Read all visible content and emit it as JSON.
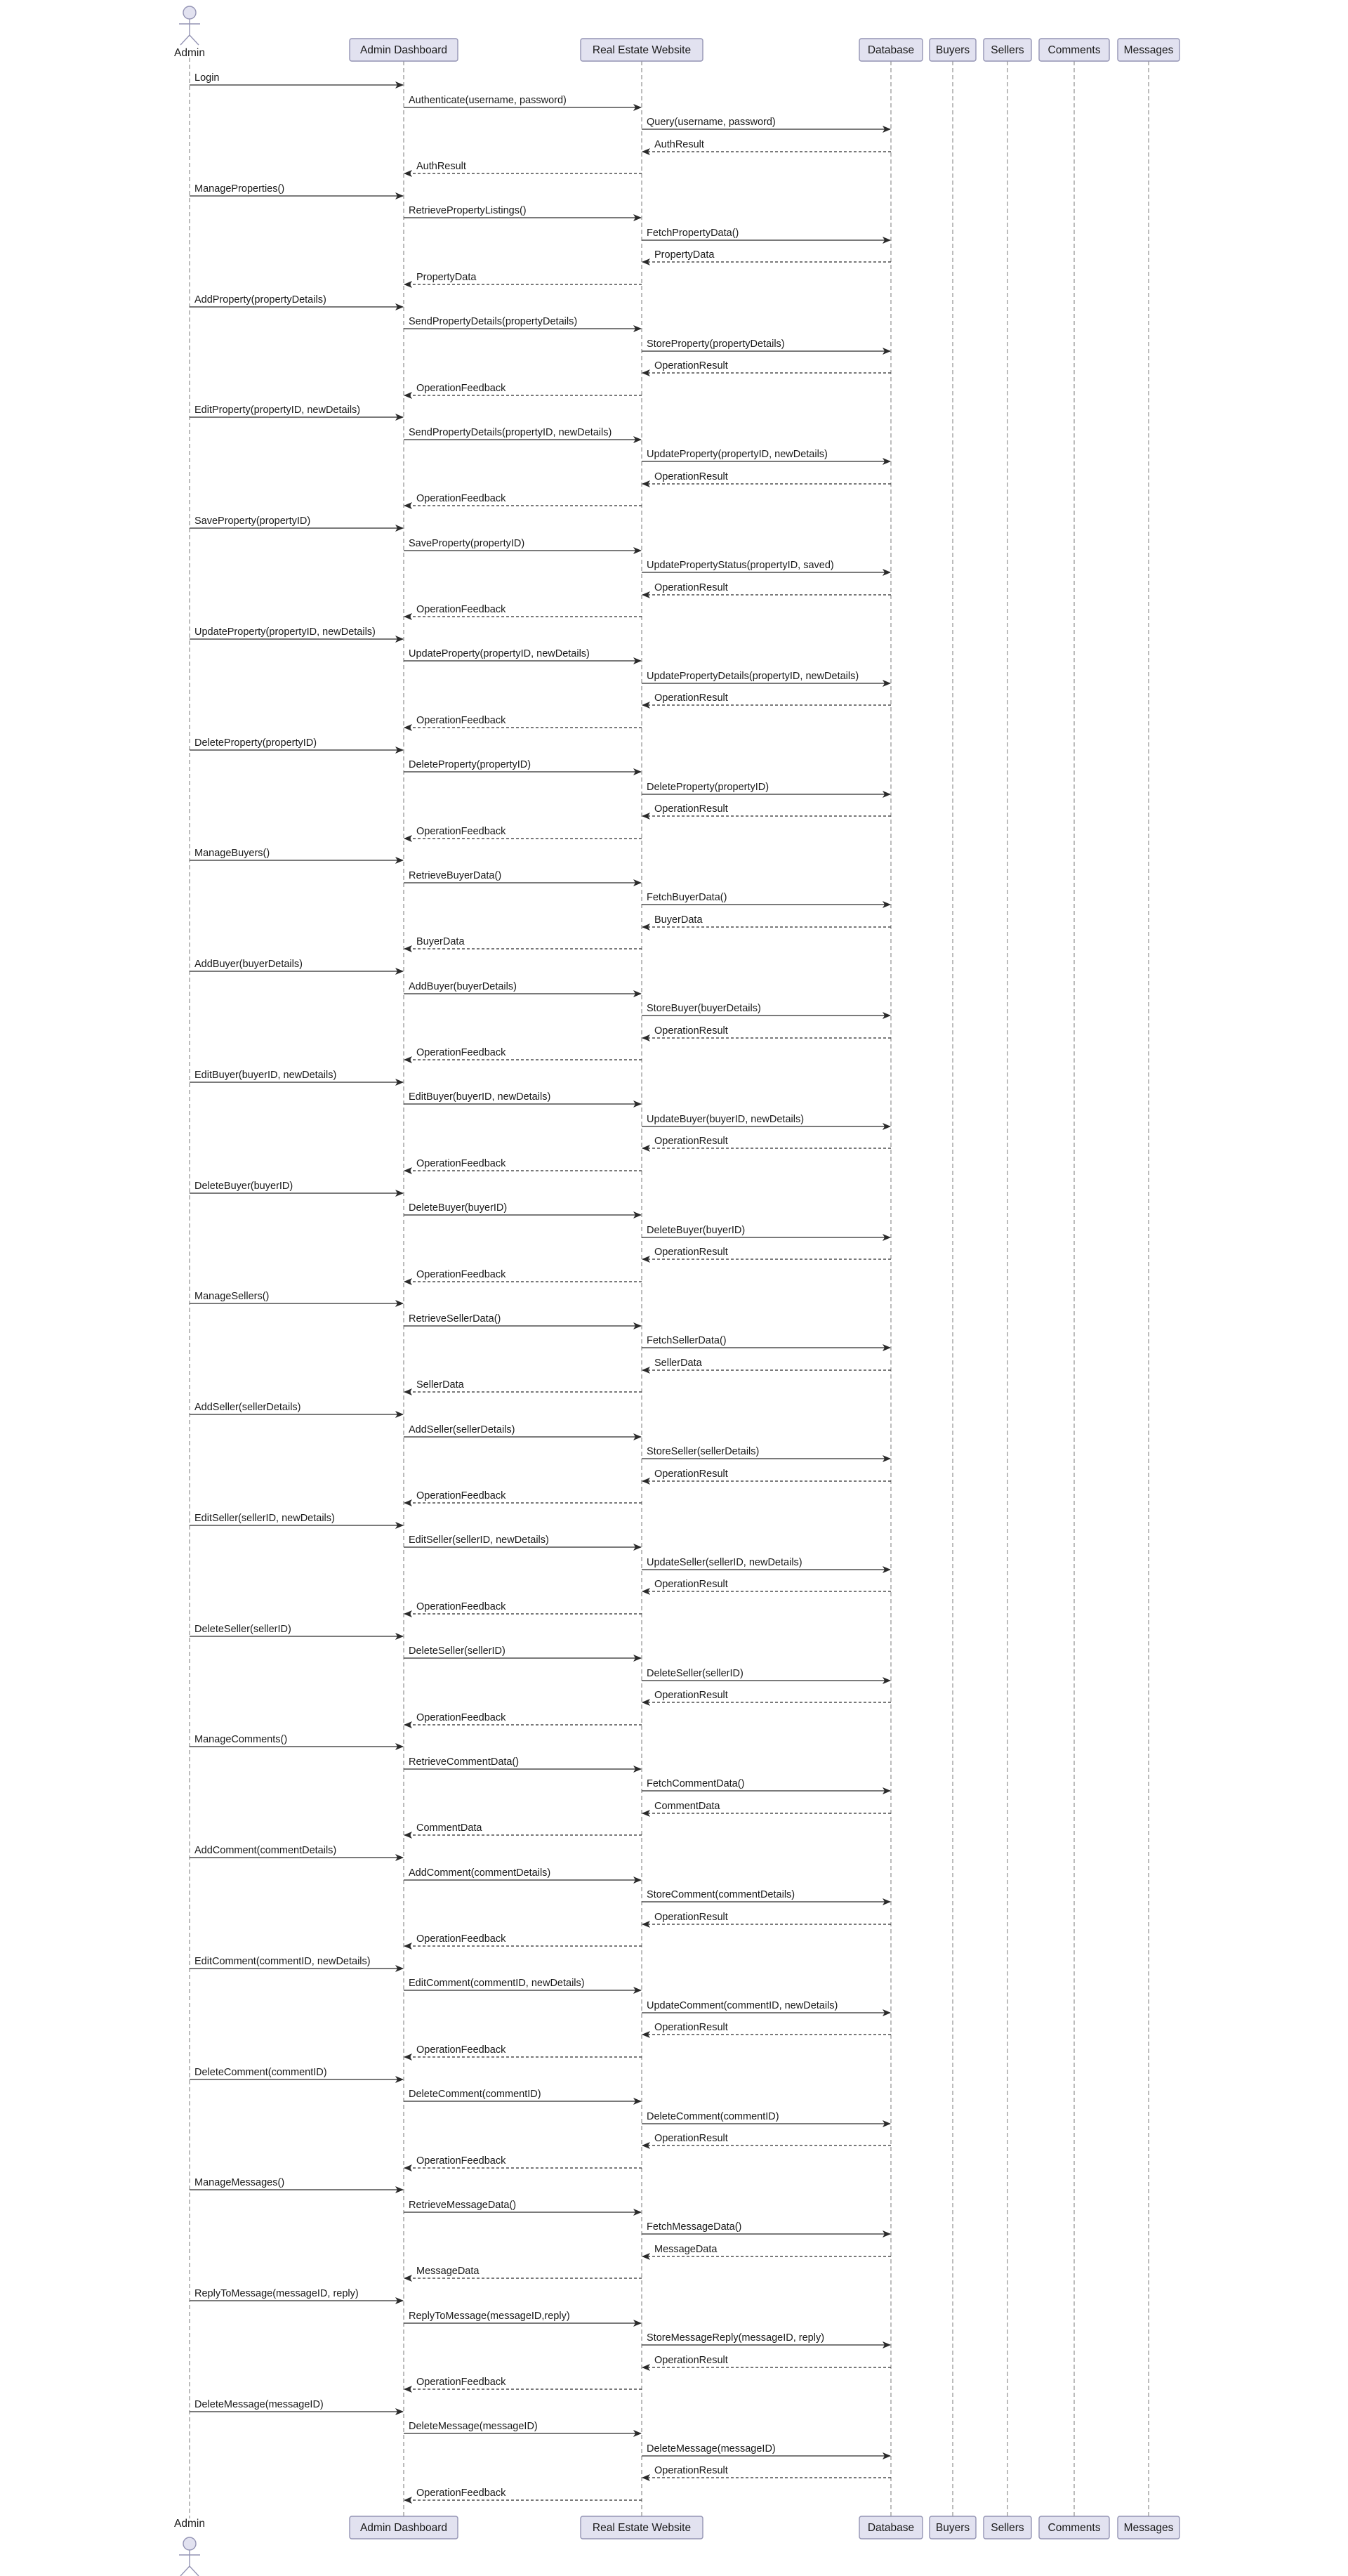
{
  "participants": [
    {
      "id": "admin",
      "label": "Admin",
      "kind": "actor"
    },
    {
      "id": "dashboard",
      "label": "Admin Dashboard",
      "kind": "box"
    },
    {
      "id": "website",
      "label": "Real Estate Website",
      "kind": "box"
    },
    {
      "id": "database",
      "label": "Database",
      "kind": "box"
    },
    {
      "id": "buyers",
      "label": "Buyers",
      "kind": "box"
    },
    {
      "id": "sellers",
      "label": "Sellers",
      "kind": "box"
    },
    {
      "id": "comments",
      "label": "Comments",
      "kind": "box"
    },
    {
      "id": "messages",
      "label": "Messages",
      "kind": "box"
    }
  ],
  "messages": [
    {
      "from": "admin",
      "to": "dashboard",
      "label": "Login",
      "type": "sync"
    },
    {
      "from": "dashboard",
      "to": "website",
      "label": "Authenticate(username, password)",
      "type": "sync"
    },
    {
      "from": "website",
      "to": "database",
      "label": "Query(username, password)",
      "type": "sync"
    },
    {
      "from": "database",
      "to": "website",
      "label": "AuthResult",
      "type": "return"
    },
    {
      "from": "website",
      "to": "dashboard",
      "label": "AuthResult",
      "type": "return"
    },
    {
      "from": "admin",
      "to": "dashboard",
      "label": "ManageProperties()",
      "type": "sync"
    },
    {
      "from": "dashboard",
      "to": "website",
      "label": "RetrievePropertyListings()",
      "type": "sync"
    },
    {
      "from": "website",
      "to": "database",
      "label": "FetchPropertyData()",
      "type": "sync"
    },
    {
      "from": "database",
      "to": "website",
      "label": "PropertyData",
      "type": "return"
    },
    {
      "from": "website",
      "to": "dashboard",
      "label": "PropertyData",
      "type": "return"
    },
    {
      "from": "admin",
      "to": "dashboard",
      "label": "AddProperty(propertyDetails)",
      "type": "sync"
    },
    {
      "from": "dashboard",
      "to": "website",
      "label": "SendPropertyDetails(propertyDetails)",
      "type": "sync"
    },
    {
      "from": "website",
      "to": "database",
      "label": "StoreProperty(propertyDetails)",
      "type": "sync"
    },
    {
      "from": "database",
      "to": "website",
      "label": "OperationResult",
      "type": "return"
    },
    {
      "from": "website",
      "to": "dashboard",
      "label": "OperationFeedback",
      "type": "return"
    },
    {
      "from": "admin",
      "to": "dashboard",
      "label": "EditProperty(propertyID, newDetails)",
      "type": "sync"
    },
    {
      "from": "dashboard",
      "to": "website",
      "label": "SendPropertyDetails(propertyID, newDetails)",
      "type": "sync"
    },
    {
      "from": "website",
      "to": "database",
      "label": "UpdateProperty(propertyID, newDetails)",
      "type": "sync"
    },
    {
      "from": "database",
      "to": "website",
      "label": "OperationResult",
      "type": "return"
    },
    {
      "from": "website",
      "to": "dashboard",
      "label": "OperationFeedback",
      "type": "return"
    },
    {
      "from": "admin",
      "to": "dashboard",
      "label": "SaveProperty(propertyID)",
      "type": "sync"
    },
    {
      "from": "dashboard",
      "to": "website",
      "label": "SaveProperty(propertyID)",
      "type": "sync"
    },
    {
      "from": "website",
      "to": "database",
      "label": "UpdatePropertyStatus(propertyID, saved)",
      "type": "sync"
    },
    {
      "from": "database",
      "to": "website",
      "label": "OperationResult",
      "type": "return"
    },
    {
      "from": "website",
      "to": "dashboard",
      "label": "OperationFeedback",
      "type": "return"
    },
    {
      "from": "admin",
      "to": "dashboard",
      "label": "UpdateProperty(propertyID, newDetails)",
      "type": "sync"
    },
    {
      "from": "dashboard",
      "to": "website",
      "label": "UpdateProperty(propertyID, newDetails)",
      "type": "sync"
    },
    {
      "from": "website",
      "to": "database",
      "label": "UpdatePropertyDetails(propertyID, newDetails)",
      "type": "sync"
    },
    {
      "from": "database",
      "to": "website",
      "label": "OperationResult",
      "type": "return"
    },
    {
      "from": "website",
      "to": "dashboard",
      "label": "OperationFeedback",
      "type": "return"
    },
    {
      "from": "admin",
      "to": "dashboard",
      "label": "DeleteProperty(propertyID)",
      "type": "sync"
    },
    {
      "from": "dashboard",
      "to": "website",
      "label": "DeleteProperty(propertyID)",
      "type": "sync"
    },
    {
      "from": "website",
      "to": "database",
      "label": "DeleteProperty(propertyID)",
      "type": "sync"
    },
    {
      "from": "database",
      "to": "website",
      "label": "OperationResult",
      "type": "return"
    },
    {
      "from": "website",
      "to": "dashboard",
      "label": "OperationFeedback",
      "type": "return"
    },
    {
      "from": "admin",
      "to": "dashboard",
      "label": "ManageBuyers()",
      "type": "sync"
    },
    {
      "from": "dashboard",
      "to": "website",
      "label": "RetrieveBuyerData()",
      "type": "sync"
    },
    {
      "from": "website",
      "to": "database",
      "label": "FetchBuyerData()",
      "type": "sync"
    },
    {
      "from": "database",
      "to": "website",
      "label": "BuyerData",
      "type": "return"
    },
    {
      "from": "website",
      "to": "dashboard",
      "label": "BuyerData",
      "type": "return"
    },
    {
      "from": "admin",
      "to": "dashboard",
      "label": "AddBuyer(buyerDetails)",
      "type": "sync"
    },
    {
      "from": "dashboard",
      "to": "website",
      "label": "AddBuyer(buyerDetails)",
      "type": "sync"
    },
    {
      "from": "website",
      "to": "database",
      "label": "StoreBuyer(buyerDetails)",
      "type": "sync"
    },
    {
      "from": "database",
      "to": "website",
      "label": "OperationResult",
      "type": "return"
    },
    {
      "from": "website",
      "to": "dashboard",
      "label": "OperationFeedback",
      "type": "return"
    },
    {
      "from": "admin",
      "to": "dashboard",
      "label": "EditBuyer(buyerID, newDetails)",
      "type": "sync"
    },
    {
      "from": "dashboard",
      "to": "website",
      "label": "EditBuyer(buyerID, newDetails)",
      "type": "sync"
    },
    {
      "from": "website",
      "to": "database",
      "label": "UpdateBuyer(buyerID, newDetails)",
      "type": "sync"
    },
    {
      "from": "database",
      "to": "website",
      "label": "OperationResult",
      "type": "return"
    },
    {
      "from": "website",
      "to": "dashboard",
      "label": "OperationFeedback",
      "type": "return"
    },
    {
      "from": "admin",
      "to": "dashboard",
      "label": "DeleteBuyer(buyerID)",
      "type": "sync"
    },
    {
      "from": "dashboard",
      "to": "website",
      "label": "DeleteBuyer(buyerID)",
      "type": "sync"
    },
    {
      "from": "website",
      "to": "database",
      "label": "DeleteBuyer(buyerID)",
      "type": "sync"
    },
    {
      "from": "database",
      "to": "website",
      "label": "OperationResult",
      "type": "return"
    },
    {
      "from": "website",
      "to": "dashboard",
      "label": "OperationFeedback",
      "type": "return"
    },
    {
      "from": "admin",
      "to": "dashboard",
      "label": "ManageSellers()",
      "type": "sync"
    },
    {
      "from": "dashboard",
      "to": "website",
      "label": "RetrieveSellerData()",
      "type": "sync"
    },
    {
      "from": "website",
      "to": "database",
      "label": "FetchSellerData()",
      "type": "sync"
    },
    {
      "from": "database",
      "to": "website",
      "label": "SellerData",
      "type": "return"
    },
    {
      "from": "website",
      "to": "dashboard",
      "label": "SellerData",
      "type": "return"
    },
    {
      "from": "admin",
      "to": "dashboard",
      "label": "AddSeller(sellerDetails)",
      "type": "sync"
    },
    {
      "from": "dashboard",
      "to": "website",
      "label": "AddSeller(sellerDetails)",
      "type": "sync"
    },
    {
      "from": "website",
      "to": "database",
      "label": "StoreSeller(sellerDetails)",
      "type": "sync"
    },
    {
      "from": "database",
      "to": "website",
      "label": "OperationResult",
      "type": "return"
    },
    {
      "from": "website",
      "to": "dashboard",
      "label": "OperationFeedback",
      "type": "return"
    },
    {
      "from": "admin",
      "to": "dashboard",
      "label": "EditSeller(sellerID, newDetails)",
      "type": "sync"
    },
    {
      "from": "dashboard",
      "to": "website",
      "label": "EditSeller(sellerID, newDetails)",
      "type": "sync"
    },
    {
      "from": "website",
      "to": "database",
      "label": "UpdateSeller(sellerID, newDetails)",
      "type": "sync"
    },
    {
      "from": "database",
      "to": "website",
      "label": "OperationResult",
      "type": "return"
    },
    {
      "from": "website",
      "to": "dashboard",
      "label": "OperationFeedback",
      "type": "return"
    },
    {
      "from": "admin",
      "to": "dashboard",
      "label": "DeleteSeller(sellerID)",
      "type": "sync"
    },
    {
      "from": "dashboard",
      "to": "website",
      "label": "DeleteSeller(sellerID)",
      "type": "sync"
    },
    {
      "from": "website",
      "to": "database",
      "label": "DeleteSeller(sellerID)",
      "type": "sync"
    },
    {
      "from": "database",
      "to": "website",
      "label": "OperationResult",
      "type": "return"
    },
    {
      "from": "website",
      "to": "dashboard",
      "label": "OperationFeedback",
      "type": "return"
    },
    {
      "from": "admin",
      "to": "dashboard",
      "label": "ManageComments()",
      "type": "sync"
    },
    {
      "from": "dashboard",
      "to": "website",
      "label": "RetrieveCommentData()",
      "type": "sync"
    },
    {
      "from": "website",
      "to": "database",
      "label": "FetchCommentData()",
      "type": "sync"
    },
    {
      "from": "database",
      "to": "website",
      "label": "CommentData",
      "type": "return"
    },
    {
      "from": "website",
      "to": "dashboard",
      "label": "CommentData",
      "type": "return"
    },
    {
      "from": "admin",
      "to": "dashboard",
      "label": "AddComment(commentDetails)",
      "type": "sync"
    },
    {
      "from": "dashboard",
      "to": "website",
      "label": "AddComment(commentDetails)",
      "type": "sync"
    },
    {
      "from": "website",
      "to": "database",
      "label": "StoreComment(commentDetails)",
      "type": "sync"
    },
    {
      "from": "database",
      "to": "website",
      "label": "OperationResult",
      "type": "return"
    },
    {
      "from": "website",
      "to": "dashboard",
      "label": "OperationFeedback",
      "type": "return"
    },
    {
      "from": "admin",
      "to": "dashboard",
      "label": "EditComment(commentID, newDetails)",
      "type": "sync"
    },
    {
      "from": "dashboard",
      "to": "website",
      "label": "EditComment(commentID, newDetails)",
      "type": "sync"
    },
    {
      "from": "website",
      "to": "database",
      "label": "UpdateComment(commentID, newDetails)",
      "type": "sync"
    },
    {
      "from": "database",
      "to": "website",
      "label": "OperationResult",
      "type": "return"
    },
    {
      "from": "website",
      "to": "dashboard",
      "label": "OperationFeedback",
      "type": "return"
    },
    {
      "from": "admin",
      "to": "dashboard",
      "label": "DeleteComment(commentID)",
      "type": "sync"
    },
    {
      "from": "dashboard",
      "to": "website",
      "label": "DeleteComment(commentID)",
      "type": "sync"
    },
    {
      "from": "website",
      "to": "database",
      "label": "DeleteComment(commentID)",
      "type": "sync"
    },
    {
      "from": "database",
      "to": "website",
      "label": "OperationResult",
      "type": "return"
    },
    {
      "from": "website",
      "to": "dashboard",
      "label": "OperationFeedback",
      "type": "return"
    },
    {
      "from": "admin",
      "to": "dashboard",
      "label": "ManageMessages()",
      "type": "sync"
    },
    {
      "from": "dashboard",
      "to": "website",
      "label": "RetrieveMessageData()",
      "type": "sync"
    },
    {
      "from": "website",
      "to": "database",
      "label": "FetchMessageData()",
      "type": "sync"
    },
    {
      "from": "database",
      "to": "website",
      "label": "MessageData",
      "type": "return"
    },
    {
      "from": "website",
      "to": "dashboard",
      "label": "MessageData",
      "type": "return"
    },
    {
      "from": "admin",
      "to": "dashboard",
      "label": "ReplyToMessage(messageID, reply)",
      "type": "sync"
    },
    {
      "from": "dashboard",
      "to": "website",
      "label": "ReplyToMessage(messageID,reply)",
      "type": "sync"
    },
    {
      "from": "website",
      "to": "database",
      "label": "StoreMessageReply(messageID, reply)",
      "type": "sync"
    },
    {
      "from": "database",
      "to": "website",
      "label": "OperationResult",
      "type": "return"
    },
    {
      "from": "website",
      "to": "dashboard",
      "label": "OperationFeedback",
      "type": "return"
    },
    {
      "from": "admin",
      "to": "dashboard",
      "label": "DeleteMessage(messageID)",
      "type": "sync"
    },
    {
      "from": "dashboard",
      "to": "website",
      "label": "DeleteMessage(messageID)",
      "type": "sync"
    },
    {
      "from": "website",
      "to": "database",
      "label": "DeleteMessage(messageID)",
      "type": "sync"
    },
    {
      "from": "database",
      "to": "website",
      "label": "OperationResult",
      "type": "return"
    },
    {
      "from": "website",
      "to": "dashboard",
      "label": "OperationFeedback",
      "type": "return"
    }
  ]
}
